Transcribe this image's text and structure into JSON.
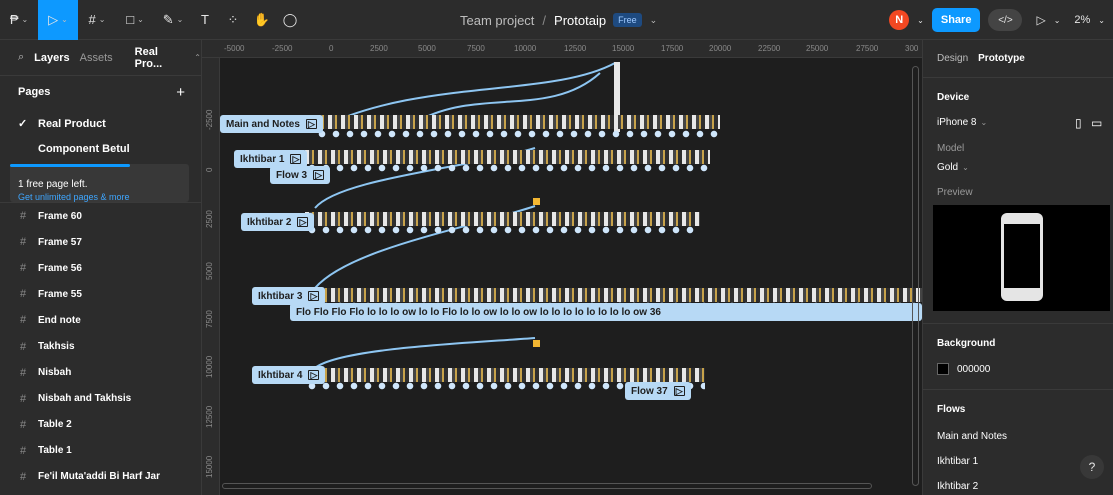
{
  "toolbar": {
    "tools": [
      {
        "glyph": "₱",
        "name": "main-menu"
      },
      {
        "glyph": "▷",
        "name": "move-tool"
      },
      {
        "glyph": "#",
        "name": "frame-tool"
      },
      {
        "glyph": "□",
        "name": "shape-tool"
      },
      {
        "glyph": "✎",
        "name": "pen-tool"
      },
      {
        "glyph": "T",
        "name": "text-tool"
      },
      {
        "glyph": "⁘",
        "name": "resources-tool"
      },
      {
        "glyph": "✋",
        "name": "hand-tool"
      },
      {
        "glyph": "◯",
        "name": "comment-tool"
      }
    ],
    "team": "Team project",
    "separator": "/",
    "file": "Prototaip",
    "badge": "Free",
    "avatar_initial": "N",
    "share_label": "Share",
    "code_label": "</>",
    "zoom": "2%"
  },
  "left_panel": {
    "tab_layers": "Layers",
    "tab_assets": "Assets",
    "page_selector": "Real Pro...",
    "pages_header": "Pages",
    "add_page": "+",
    "pages": [
      "Real Product",
      "Component Betul"
    ],
    "upsell_text": "1 free page left.",
    "upsell_link": "Get unlimited pages & more",
    "layers": [
      "Frame 60",
      "Frame 57",
      "Frame 56",
      "Frame 55",
      "End note",
      "Takhsis",
      "Nisbah",
      "Nisbah and Takhsis",
      "Table 2",
      "Table 1",
      "Fe'il Muta'addi Bi Harf Jar"
    ]
  },
  "rulers": {
    "top": [
      "-5000",
      "-2500",
      "0",
      "2500",
      "5000",
      "7500",
      "10000",
      "12500",
      "15000",
      "17500",
      "20000",
      "22500",
      "25000",
      "27500",
      "300"
    ],
    "left": [
      "-2500",
      "0",
      "2500",
      "5000",
      "7500",
      "10000",
      "12500",
      "15000"
    ]
  },
  "canvas": {
    "flows": [
      {
        "label": "Main and Notes"
      },
      {
        "label": "Ikhtibar 1"
      },
      {
        "label": "Flow 3"
      },
      {
        "label": "Ikhtibar 2"
      },
      {
        "label": "Ikhtibar 3"
      },
      {
        "label": "Ikhtibar 4"
      },
      {
        "label": "Flow 37"
      }
    ],
    "flo_row": "Flo  Flo  Flo  Flo  lo  lo  lo  ow  lo  lo  Flo  lo  lo  ow  lo  lo  ow  lo  lo  lo  lo  lo  lo  lo  lo  ow 36"
  },
  "right_panel": {
    "tab_design": "Design",
    "tab_prototype": "Prototype",
    "device_header": "Device",
    "device": "iPhone 8",
    "model_label": "Model",
    "model": "Gold",
    "preview_label": "Preview",
    "background_header": "Background",
    "background_value": "000000",
    "flows_header": "Flows",
    "flows": [
      "Main and Notes",
      "Ikhtibar 1",
      "Ikhtibar 2"
    ]
  },
  "help": "?"
}
